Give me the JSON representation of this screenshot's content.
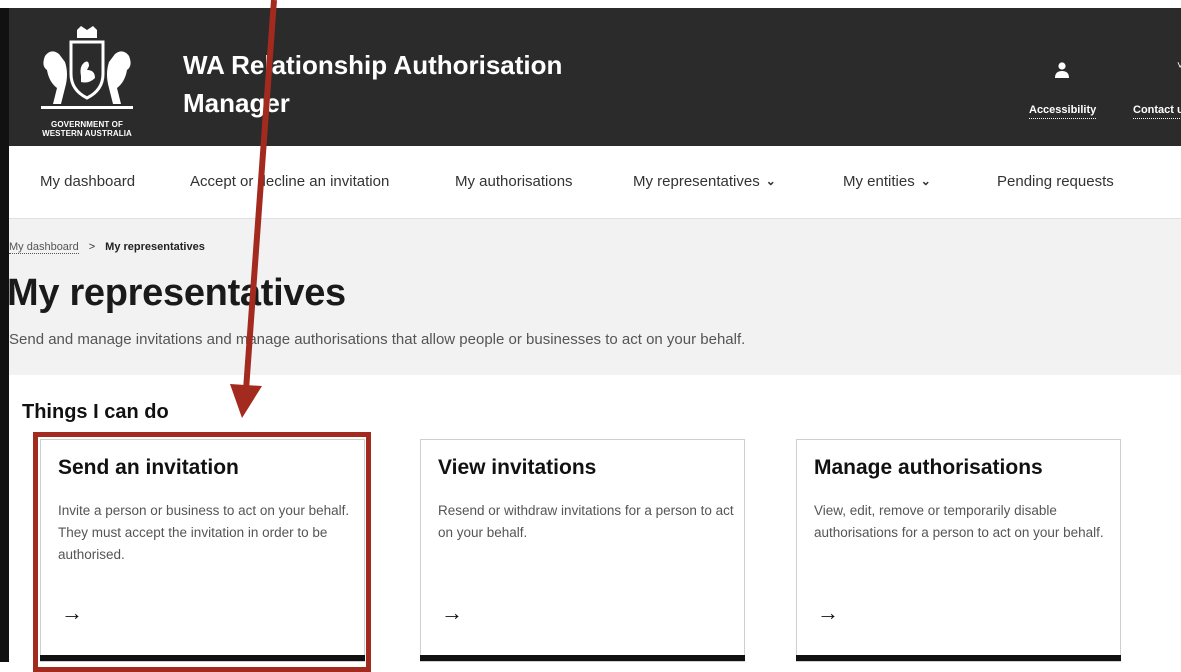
{
  "header": {
    "crest_label_line1": "GOVERNMENT OF",
    "crest_label_line2": "WESTERN AUSTRALIA",
    "app_title_line1": "WA Relationship Authorisation",
    "app_title_line2": "Manager",
    "user_icon": "user-icon",
    "user_chevron": "˅",
    "links": {
      "accessibility": "Accessibility",
      "contact": "Contact us"
    }
  },
  "nav": {
    "items": [
      {
        "label": "My dashboard"
      },
      {
        "label": "Accept or decline an invitation"
      },
      {
        "label": "My authorisations"
      },
      {
        "label": "My representatives",
        "has_dropdown": true
      },
      {
        "label": "My entities",
        "has_dropdown": true
      },
      {
        "label": "Pending requests"
      }
    ],
    "chevron": "⌄"
  },
  "breadcrumb": {
    "home": "My dashboard",
    "separator": ">",
    "current": "My representatives"
  },
  "page": {
    "title": "My representatives",
    "description": "Send and manage invitations and manage authorisations that allow people or businesses to act on your behalf."
  },
  "section": {
    "title": "Things I can do"
  },
  "cards": [
    {
      "title": "Send an invitation",
      "description": "Invite a person or business to act on your behalf. They must accept the invitation in order to be authorised.",
      "arrow": "→"
    },
    {
      "title": "View invitations",
      "description": "Resend or withdraw invitations for a person to act on your behalf.",
      "arrow": "→"
    },
    {
      "title": "Manage authorisations",
      "description": "View, edit, remove or temporarily disable authorisations for a person to act on your behalf.",
      "arrow": "→"
    }
  ],
  "colors": {
    "header_bg": "#2b2b2b",
    "band_bg": "#f2f2f2",
    "annotation": "#a32a1f"
  }
}
